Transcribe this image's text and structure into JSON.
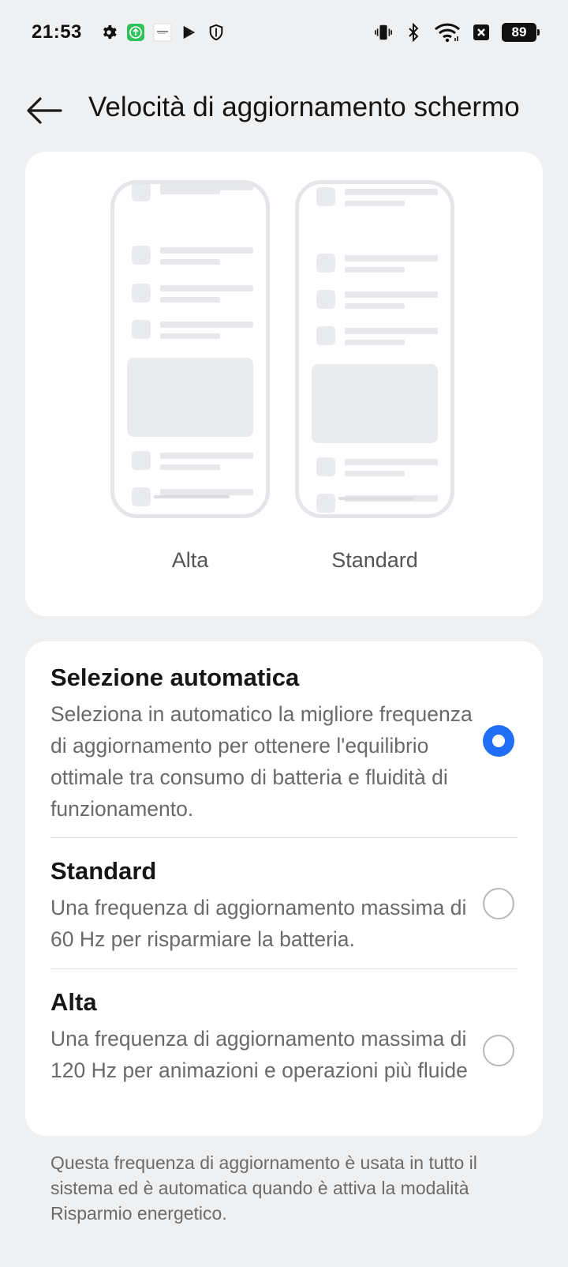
{
  "status_bar": {
    "time": "21:53",
    "left_icons": [
      "gear-icon",
      "green-upload-icon",
      "app-thumbnail-icon",
      "play-store-icon",
      "shield-icon"
    ],
    "right_icons": [
      "vibrate-icon",
      "bluetooth-icon",
      "wifi-icon",
      "x-box-icon"
    ],
    "battery": "89"
  },
  "header": {
    "title": "Velocità di aggiornamento schermo"
  },
  "preview": {
    "labels": [
      "Alta",
      "Standard"
    ]
  },
  "options": [
    {
      "title": "Selezione automatica",
      "description": "Seleziona in automatico la migliore frequenza di aggiornamento per ottenere l'equilibrio ottimale tra consumo di batteria e fluidità di funzionamento.",
      "selected": true
    },
    {
      "title": "Standard",
      "description": "Una frequenza di aggiornamento massima di 60 Hz per risparmiare la batteria.",
      "selected": false
    },
    {
      "title": "Alta",
      "description": "Una frequenza di aggiornamento massima di 120 Hz per animazioni e operazioni più fluide",
      "selected": false
    }
  ],
  "footer_note": "Questa frequenza di aggiornamento è usata in tutto il sistema ed è automatica quando è attiva la modalità Risparmio energetico.",
  "colors": {
    "accent": "#1f6ef5",
    "background": "#eff0f2",
    "card": "#ffffff"
  }
}
